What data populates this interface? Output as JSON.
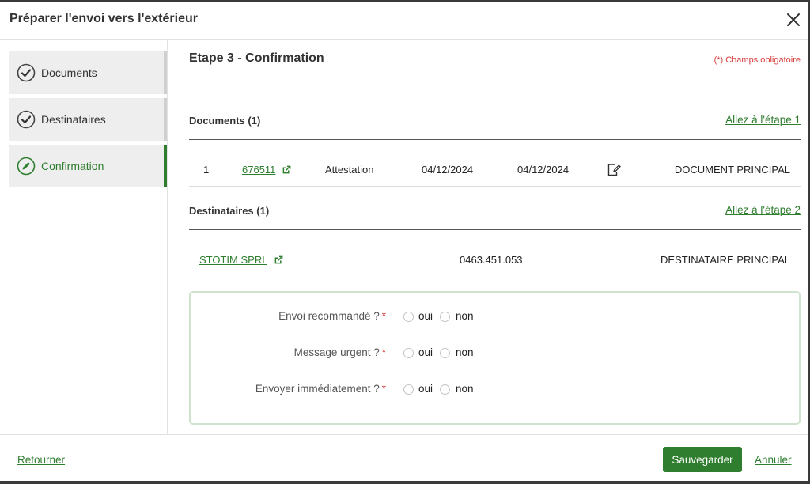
{
  "dialog": {
    "title": "Préparer l'envoi vers l'extérieur"
  },
  "steps": [
    {
      "label": "Documents",
      "state": "done"
    },
    {
      "label": "Destinataires",
      "state": "done"
    },
    {
      "label": "Confirmation",
      "state": "active"
    }
  ],
  "content": {
    "heading": "Etape 3 - Confirmation",
    "required_note": "(*) Champs obligatoire",
    "documents": {
      "title": "Documents (1)",
      "goto_label": "Allez à l'étape 1",
      "rows": [
        {
          "index": "1",
          "number": "676511",
          "type": "Attestation",
          "date1": "04/12/2024",
          "date2": "04/12/2024",
          "role": "DOCUMENT PRINCIPAL"
        }
      ]
    },
    "recipients": {
      "title": "Destinataires (1)",
      "goto_label": "Allez à l'étape 2",
      "rows": [
        {
          "name": "STOTIM SPRL",
          "number": "0463.451.053",
          "role": "DESTINATAIRE PRINCIPAL"
        }
      ]
    },
    "questions": [
      {
        "label": "Envoi recommandé ?",
        "required_mark": "*",
        "yes": "oui",
        "no": "non"
      },
      {
        "label": "Message urgent ?",
        "required_mark": "*",
        "yes": "oui",
        "no": "non"
      },
      {
        "label": "Envoyer immédiatement ?",
        "required_mark": "*",
        "yes": "oui",
        "no": "non"
      }
    ]
  },
  "footer": {
    "back_label": "Retourner",
    "save_label": "Sauvegarder",
    "cancel_label": "Annuler"
  },
  "colors": {
    "accent": "#2f7d2f",
    "required": "#d83a3a"
  }
}
